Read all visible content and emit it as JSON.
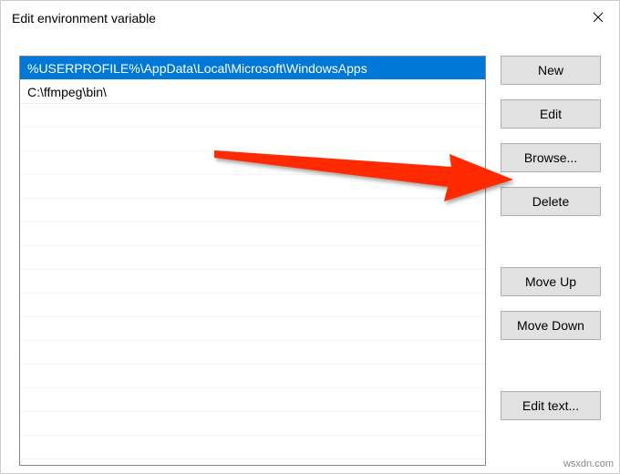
{
  "titlebar": {
    "title": "Edit environment variable"
  },
  "list": {
    "rows": [
      {
        "text": "%USERPROFILE%\\AppData\\Local\\Microsoft\\WindowsApps",
        "selected": true
      },
      {
        "text": "C:\\ffmpeg\\bin\\",
        "selected": false
      }
    ]
  },
  "buttons": {
    "new": "New",
    "edit": "Edit",
    "browse": "Browse...",
    "delete": "Delete",
    "move_up": "Move Up",
    "move_down": "Move Down",
    "edit_text": "Edit text..."
  },
  "watermark": "wsxdn.com"
}
